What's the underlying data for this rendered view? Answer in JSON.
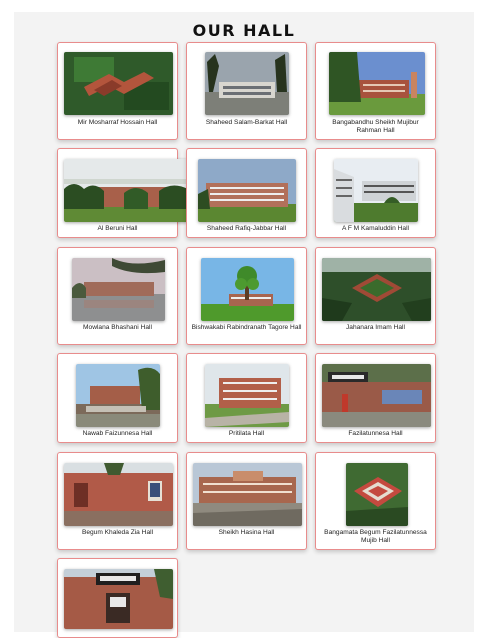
{
  "title": "OUR HALL",
  "halls": [
    {
      "name": "Mir Mosharraf Hossain Hall"
    },
    {
      "name": "Shaheed Salam-Barkat Hall"
    },
    {
      "name": "Bangabandhu Sheikh Mujibur Rahman Hall"
    },
    {
      "name": "Al Beruni Hall"
    },
    {
      "name": "Shaheed Rafiq-Jabbar Hall"
    },
    {
      "name": "A F M Kamaluddin Hall"
    },
    {
      "name": "Mowlana Bhashani Hall"
    },
    {
      "name": "Bishwakabi Rabindranath Tagore Hall"
    },
    {
      "name": "Jahanara Imam Hall"
    },
    {
      "name": "Nawab Faizunnesa Hall"
    },
    {
      "name": "Pritilata Hall"
    },
    {
      "name": "Fazilatunnesa Hall"
    },
    {
      "name": "Begum Khaleda Zia Hall"
    },
    {
      "name": "Sheikh Hasina Hall"
    },
    {
      "name": "Bangamata Begum Fazilatunnessa Mujib Hall"
    },
    {
      "name": ""
    }
  ],
  "colors": {
    "card_border": "#e88c8c",
    "background": "#f3f3f3"
  }
}
